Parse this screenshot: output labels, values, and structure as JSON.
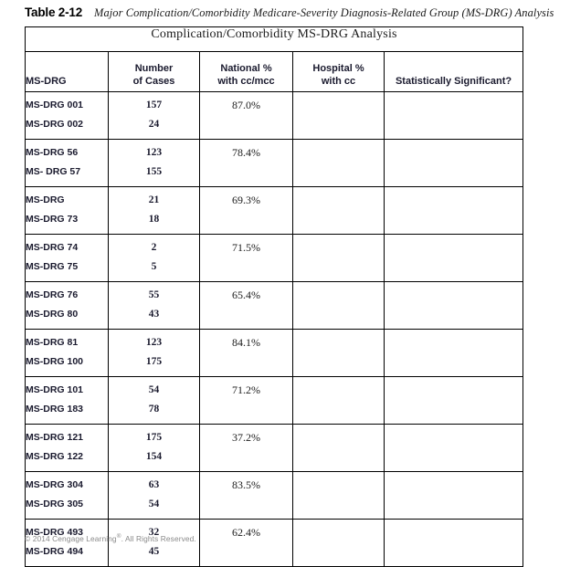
{
  "caption": {
    "label": "Table 2-12",
    "text": "Major Complication/Comorbidity Medicare-Severity Diagnosis-Related Group (MS-DRG) Analysis"
  },
  "table": {
    "banner": "Complication/Comorbidity MS-DRG Analysis",
    "headers": [
      "MS-DRG",
      "Number\nof Cases",
      "National %\nwith cc/mcc",
      "Hospital %\nwith cc",
      "Statistically Significant?"
    ],
    "headers_lines": {
      "col1": "MS-DRG",
      "col2_line1": "Number",
      "col2_line2": "of Cases",
      "col3_line1": "National %",
      "col3_line2": "with cc/mcc",
      "col4_line1": "Hospital %",
      "col4_line2": "with cc",
      "col5": "Statistically Significant?"
    },
    "rows": [
      {
        "drg_1": "MS-DRG 001",
        "drg_2": "MS-DRG 002",
        "cases_1": "157",
        "cases_2": "24",
        "national_pct": "87.0%",
        "hospital_pct": "",
        "significant": ""
      },
      {
        "drg_1": "MS-DRG 56",
        "drg_2": "MS- DRG 57",
        "cases_1": "123",
        "cases_2": "155",
        "national_pct": "78.4%",
        "hospital_pct": "",
        "significant": ""
      },
      {
        "drg_1": "MS-DRG",
        "drg_2": "MS-DRG 73",
        "cases_1": "21",
        "cases_2": "18",
        "national_pct": "69.3%",
        "hospital_pct": "",
        "significant": ""
      },
      {
        "drg_1": "MS-DRG 74",
        "drg_2": "MS-DRG 75",
        "cases_1": "2",
        "cases_2": "5",
        "national_pct": "71.5%",
        "hospital_pct": "",
        "significant": ""
      },
      {
        "drg_1": "MS-DRG 76",
        "drg_2": "MS-DRG 80",
        "cases_1": "55",
        "cases_2": "43",
        "national_pct": "65.4%",
        "hospital_pct": "",
        "significant": ""
      },
      {
        "drg_1": "MS-DRG 81",
        "drg_2": "MS-DRG 100",
        "cases_1": "123",
        "cases_2": "175",
        "national_pct": "84.1%",
        "hospital_pct": "",
        "significant": ""
      },
      {
        "drg_1": "MS-DRG 101",
        "drg_2": "MS-DRG 183",
        "cases_1": "54",
        "cases_2": "78",
        "national_pct": "71.2%",
        "hospital_pct": "",
        "significant": ""
      },
      {
        "drg_1": "MS-DRG 121",
        "drg_2": "MS-DRG 122",
        "cases_1": "175",
        "cases_2": "154",
        "national_pct": "37.2%",
        "hospital_pct": "",
        "significant": ""
      },
      {
        "drg_1": "MS-DRG 304",
        "drg_2": "MS-DRG 305",
        "cases_1": "63",
        "cases_2": "54",
        "national_pct": "83.5%",
        "hospital_pct": "",
        "significant": ""
      },
      {
        "drg_1": "MS-DRG 493",
        "drg_2": "MS-DRG 494",
        "cases_1": "32",
        "cases_2": "45",
        "national_pct": "62.4%",
        "hospital_pct": "",
        "significant": ""
      }
    ]
  },
  "footer": {
    "copyright_before": "© 2014 Cengage Learning",
    "registered_mark": "®",
    "copyright_after": ". All Rights Reserved."
  },
  "colors": {
    "border": "#000000",
    "heading_text": "#1a1a2e",
    "body_text": "#1b1b1b",
    "footer_text": "#8a8a8a",
    "page_background": "#ffffff"
  }
}
